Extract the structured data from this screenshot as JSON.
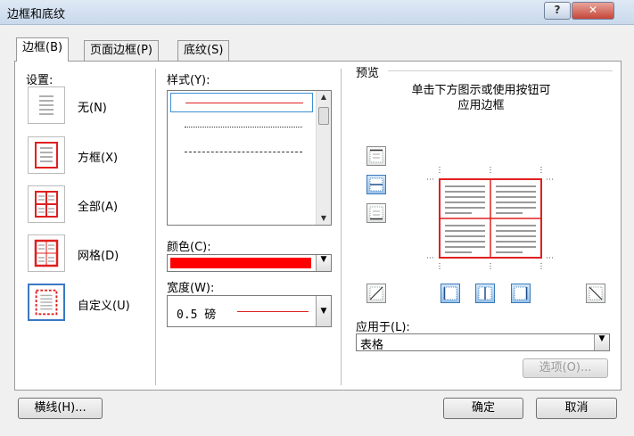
{
  "window": {
    "title": "边框和底纹",
    "help_label": "?",
    "close_label": "✕"
  },
  "tabs": [
    {
      "label": "边框(B)",
      "active": true
    },
    {
      "label": "页面边框(P)",
      "active": false
    },
    {
      "label": "底纹(S)",
      "active": false
    }
  ],
  "setting": {
    "heading": "设置:",
    "items": [
      {
        "label": "无(N)",
        "icon": "none-border-icon"
      },
      {
        "label": "方框(X)",
        "icon": "box-border-icon"
      },
      {
        "label": "全部(A)",
        "icon": "all-borders-icon"
      },
      {
        "label": "网格(D)",
        "icon": "grid-border-icon"
      },
      {
        "label": "自定义(U)",
        "icon": "custom-border-icon"
      }
    ],
    "selected": "自定义(U)"
  },
  "style": {
    "heading": "样式(Y):",
    "options": [
      "solid",
      "dotted",
      "dashed",
      "dashed-wide",
      "dash-dot"
    ],
    "selected": "solid"
  },
  "color": {
    "heading": "颜色(C):",
    "value": "#ff0000"
  },
  "width": {
    "heading": "宽度(W):",
    "value": "0.5 磅"
  },
  "preview": {
    "heading": "预览",
    "hint_line1": "单击下方图示或使用按钮可",
    "hint_line2": "应用边框",
    "border_color": "#e02020"
  },
  "apply_to": {
    "heading": "应用于(L):",
    "value": "表格"
  },
  "buttons": {
    "options": "选项(O)...",
    "horizontal_line": "横线(H)...",
    "ok": "确定",
    "cancel": "取消"
  },
  "accent": "#3a78c4"
}
